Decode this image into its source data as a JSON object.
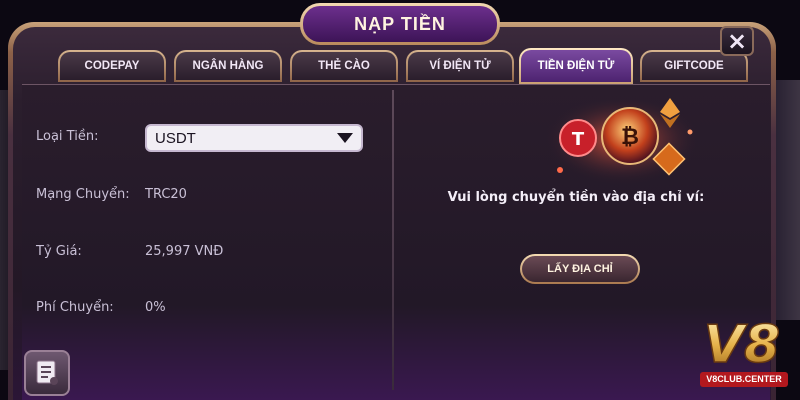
{
  "title": "NẠP TIỀN",
  "close_label": "×",
  "tabs": [
    {
      "label": "CODEPAY",
      "active": false
    },
    {
      "label": "NGÂN HÀNG",
      "active": false
    },
    {
      "label": "THẺ CÀO",
      "active": false
    },
    {
      "label": "VÍ ĐIỆN TỬ",
      "active": false
    },
    {
      "label": "TIỀN ĐIỆN TỬ",
      "active": true
    },
    {
      "label": "GIFTCODE",
      "active": false
    }
  ],
  "form": {
    "currency_label": "Loại Tiền:",
    "currency_value": "USDT",
    "network_label": "Mạng Chuyển:",
    "network_value": "TRC20",
    "rate_label": "Tỷ Giá:",
    "rate_value": "25,997 VNĐ",
    "fee_label": "Phí Chuyển:",
    "fee_value": "0%"
  },
  "right": {
    "prompt": "Vui lòng chuyển tiền vào địa chỉ ví:",
    "get_address_button": "LẤY ĐỊA CHỈ"
  },
  "logo": {
    "mark": "V8",
    "site": "V8CLUB.CENTER"
  },
  "colors": {
    "accent_purple": "#6c2f8d",
    "gold_border": "#c9a27a",
    "logo_red": "#b3181e"
  }
}
